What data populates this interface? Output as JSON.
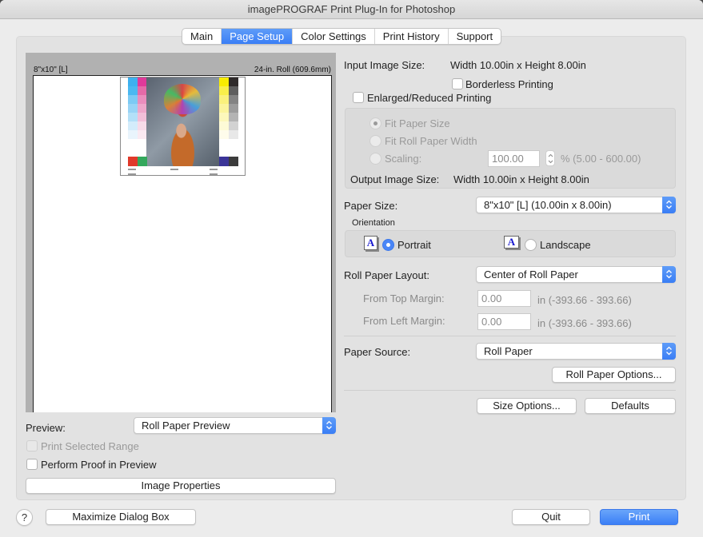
{
  "window": {
    "title": "imagePROGRAF Print Plug-In for Photoshop"
  },
  "tabs": [
    {
      "label": "Main",
      "active": false
    },
    {
      "label": "Page Setup",
      "active": true
    },
    {
      "label": "Color Settings",
      "active": false
    },
    {
      "label": "Print History",
      "active": false
    },
    {
      "label": "Support",
      "active": false
    }
  ],
  "preview": {
    "paper_label": "8\"x10\" [L]",
    "roll_label": "24-in. Roll (609.6mm)",
    "preview_label": "Preview:",
    "preview_mode": "Roll Paper Preview",
    "print_selected_range": {
      "label": "Print Selected Range",
      "checked": false,
      "enabled": false
    },
    "perform_proof": {
      "label": "Perform Proof in Preview",
      "checked": false
    },
    "image_properties_button": "Image Properties"
  },
  "page_setup": {
    "input_image_size_label": "Input Image Size:",
    "input_image_size_value": "Width 10.00in x Height 8.00in",
    "borderless_printing": {
      "label": "Borderless Printing",
      "checked": false
    },
    "enlarged_reduced": {
      "label": "Enlarged/Reduced Printing",
      "checked": false
    },
    "scaling_options": {
      "fit_paper_size": {
        "label": "Fit Paper Size",
        "selected": true,
        "enabled": false
      },
      "fit_roll_paper_width": {
        "label": "Fit Roll Paper Width",
        "selected": false,
        "enabled": false
      },
      "scaling": {
        "label": "Scaling:",
        "selected": false,
        "enabled": false,
        "value": "100.00",
        "range": "% (5.00 - 600.00)"
      }
    },
    "output_image_size_label": "Output Image Size:",
    "output_image_size_value": "Width 10.00in x Height 8.00in",
    "paper_size_label": "Paper Size:",
    "paper_size_value": "8\"x10\" [L] (10.00in x 8.00in)",
    "orientation": {
      "label": "Orientation",
      "icon_glyph": "A",
      "portrait": {
        "label": "Portrait",
        "selected": true
      },
      "landscape": {
        "label": "Landscape",
        "selected": false
      }
    },
    "roll_paper_layout_label": "Roll Paper Layout:",
    "roll_paper_layout_value": "Center of Roll Paper",
    "from_top_margin": {
      "label": "From Top Margin:",
      "value": "0.00",
      "range": "in (-393.66 - 393.66)"
    },
    "from_left_margin": {
      "label": "From Left Margin:",
      "value": "0.00",
      "range": "in (-393.66 - 393.66)"
    },
    "paper_source_label": "Paper Source:",
    "paper_source_value": "Roll Paper",
    "roll_paper_options_button": "Roll Paper Options...",
    "size_options_button": "Size Options...",
    "defaults_button": "Defaults"
  },
  "footer": {
    "help_glyph": "?",
    "maximize_button": "Maximize Dialog Box",
    "quit_button": "Quit",
    "print_button": "Print"
  },
  "colors": {
    "accent": "#3b7ff6",
    "window_bg": "#ececec",
    "panel_bg": "#e2e2e2",
    "preview_bg": "#b1b1b1"
  }
}
